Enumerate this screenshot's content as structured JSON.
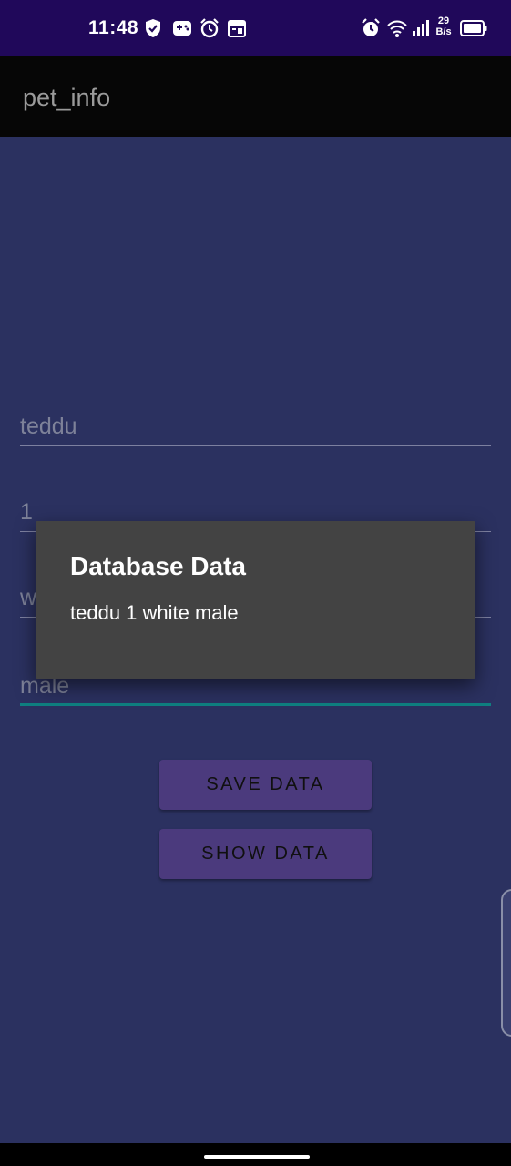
{
  "status_bar": {
    "time": "11:48",
    "net_speed_value": "29",
    "net_speed_unit": "B/s",
    "icons_left": [
      "shield-icon",
      "gamepad-icon",
      "alarm-icon",
      "calendar-icon"
    ],
    "icons_right": [
      "alarm-icon",
      "wifi-icon",
      "signal-icon",
      "battery-icon"
    ]
  },
  "app_bar": {
    "title": "pet_info"
  },
  "form": {
    "name_value": "teddu",
    "age_value": "1",
    "color_value": "w",
    "gender_value": "male"
  },
  "buttons": {
    "save_label": "SAVE DATA",
    "show_label": "SHOW DATA"
  },
  "dialog": {
    "title": "Database Data",
    "message": "teddu 1 white male"
  },
  "colors": {
    "status_bar": "#20085a",
    "app_bar": "#060606",
    "background": "#2b3160",
    "button": "#4b3a7d",
    "dialog": "#434343",
    "focus_underline": "#0f7f80"
  }
}
